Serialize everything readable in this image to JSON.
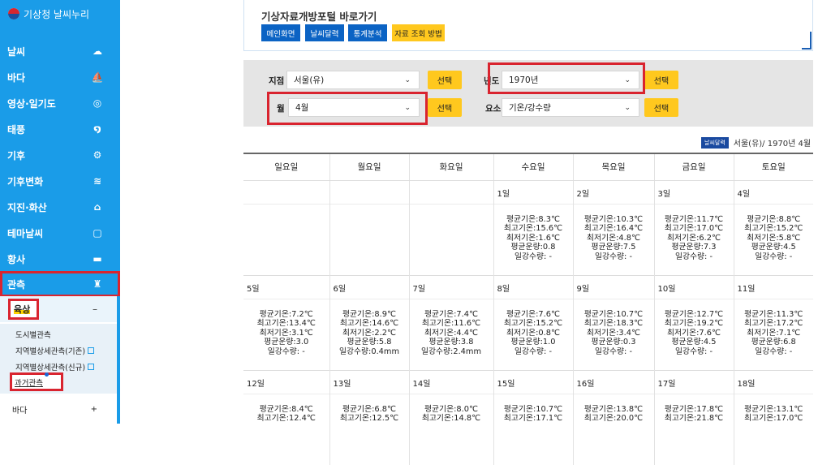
{
  "sidebar": {
    "logo": "기상청 날씨누리",
    "items": [
      {
        "label": "날씨",
        "icon": "☁"
      },
      {
        "label": "바다",
        "icon": "⛵"
      },
      {
        "label": "영상·일기도",
        "icon": "◎"
      },
      {
        "label": "태풍",
        "icon": "໑"
      },
      {
        "label": "기후",
        "icon": "⚙"
      },
      {
        "label": "기후변화",
        "icon": "≋"
      },
      {
        "label": "지진·화산",
        "icon": "⌂"
      },
      {
        "label": "테마날씨",
        "icon": "▢"
      },
      {
        "label": "황사",
        "icon": "▬"
      },
      {
        "label": "관측",
        "icon": "♜"
      }
    ],
    "submenu": {
      "head": "육상",
      "head_toggle": "–",
      "links": [
        "도시별관측",
        "지역별상세관측(기존)",
        "지역별상세관측(신규)",
        "과거관측"
      ],
      "sea": "바다",
      "sea_toggle": "+"
    }
  },
  "portal": {
    "title": "기상자료개방포털 바로가기",
    "buttons": [
      "메인화면",
      "날씨달력",
      "통계분석",
      "자료 조회 방법"
    ]
  },
  "search": {
    "station_label": "지점",
    "station_value": "서울(유)",
    "year_label": "년도",
    "year_value": "1970년",
    "month_label": "월",
    "month_value": "4월",
    "element_label": "요소",
    "element_value": "기온/강수량",
    "select_btn": "선택"
  },
  "calendar": {
    "badge": "날씨달력",
    "caption": "서울(유)/ 1970년 4월",
    "weekdays": [
      "일요일",
      "월요일",
      "화요일",
      "수요일",
      "목요일",
      "금요일",
      "토요일"
    ],
    "weeks": [
      {
        "dates": [
          "",
          "",
          "",
          "1일",
          "2일",
          "3일",
          "4일"
        ],
        "data": [
          [],
          [],
          [],
          [
            "평균기온:8.3℃",
            "최고기온:15.6℃",
            "최저기온:1.6℃",
            "평균운량:0.8",
            "일강수량: -"
          ],
          [
            "평균기온:10.3℃",
            "최고기온:16.4℃",
            "최저기온:4.8℃",
            "평균운량:7.5",
            "일강수량: -"
          ],
          [
            "평균기온:11.7℃",
            "최고기온:17.0℃",
            "최저기온:6.2℃",
            "평균운량:7.3",
            "일강수량: -"
          ],
          [
            "평균기온:8.8℃",
            "최고기온:15.2℃",
            "최저기온:5.8℃",
            "평균운량:4.5",
            "일강수량: -"
          ]
        ]
      },
      {
        "dates": [
          "5일",
          "6일",
          "7일",
          "8일",
          "9일",
          "10일",
          "11일"
        ],
        "data": [
          [
            "평균기온:7.2℃",
            "최고기온:13.4℃",
            "최저기온:3.1℃",
            "평균운량:3.0",
            "일강수량: -"
          ],
          [
            "평균기온:8.9℃",
            "최고기온:14.6℃",
            "최저기온:2.2℃",
            "평균운량:5.8",
            "일강수량:0.4mm"
          ],
          [
            "평균기온:7.4℃",
            "최고기온:11.6℃",
            "최저기온:4.4℃",
            "평균운량:3.8",
            "일강수량:2.4mm"
          ],
          [
            "평균기온:7.6℃",
            "최고기온:15.2℃",
            "최저기온:0.8℃",
            "평균운량:1.0",
            "일강수량: -"
          ],
          [
            "평균기온:10.7℃",
            "최고기온:18.3℃",
            "최저기온:3.4℃",
            "평균운량:0.3",
            "일강수량: -"
          ],
          [
            "평균기온:12.7℃",
            "최고기온:19.2℃",
            "최저기온:7.6℃",
            "평균운량:4.5",
            "일강수량: -"
          ],
          [
            "평균기온:11.3℃",
            "최고기온:17.2℃",
            "최저기온:7.1℃",
            "평균운량:6.8",
            "일강수량: -"
          ]
        ]
      },
      {
        "dates": [
          "12일",
          "13일",
          "14일",
          "15일",
          "16일",
          "17일",
          "18일"
        ],
        "data": [
          [
            "평균기온:8.4℃",
            "최고기온:12.4℃"
          ],
          [
            "평균기온:6.8℃",
            "최고기온:12.5℃"
          ],
          [
            "평균기온:8.0℃",
            "최고기온:14.8℃"
          ],
          [
            "평균기온:10.7℃",
            "최고기온:17.1℃"
          ],
          [
            "평균기온:13.8℃",
            "최고기온:20.0℃"
          ],
          [
            "평균기온:17.8℃",
            "최고기온:21.8℃"
          ],
          [
            "평균기온:13.1℃",
            "최고기온:17.0℃"
          ]
        ]
      }
    ]
  }
}
